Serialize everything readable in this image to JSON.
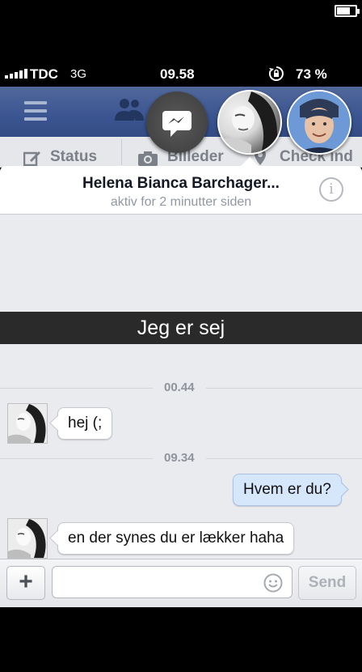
{
  "status_bar": {
    "carrier": "TDC",
    "network": "3G",
    "time": "09.58",
    "battery_percent": "73 %",
    "battery_level": 0.73
  },
  "facebook_bar": {
    "status_label": "Status",
    "photos_label": "Billeder",
    "checkin_label": "Check ind"
  },
  "chat": {
    "contact_name": "Helena Bianca Barchager...",
    "activity": "aktiv for 2 minutter siden",
    "overlay_caption": "Jeg er sej",
    "messages": [
      {
        "timestamp": "00.44"
      },
      {
        "direction": "incoming",
        "text": "hej (;"
      },
      {
        "timestamp": "09.34"
      },
      {
        "direction": "outgoing",
        "text": "Hvem er du?"
      },
      {
        "direction": "incoming",
        "text": "en der synes du er lækker haha"
      }
    ]
  },
  "composer": {
    "input_value": "",
    "send_label": "Send"
  },
  "icons": [
    "signal-bars-icon",
    "rotation-lock-icon",
    "battery-icon",
    "menu-icon",
    "friends-icon",
    "messenger-icon",
    "info-icon",
    "plus-icon",
    "smiley-icon",
    "camera-icon",
    "pencil-icon",
    "location-pin-icon"
  ],
  "colors": {
    "facebook_blue": "#3b5592",
    "outgoing_bubble": "#d6e6fb",
    "conversation_bg": "#e9ebee"
  }
}
